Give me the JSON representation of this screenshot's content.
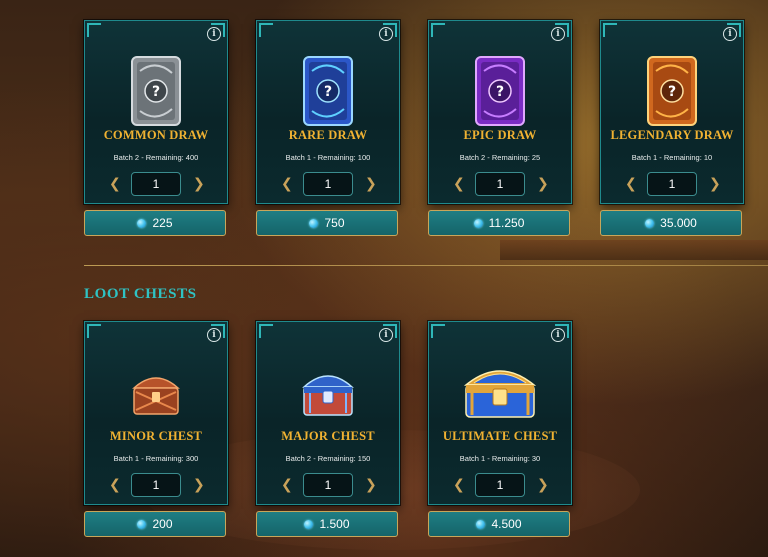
{
  "colors": {
    "title_gold": "#f0b232",
    "teal_accent": "#2fc3c3",
    "button_teal": "#1a737a",
    "gem_blue": "#46c4ef"
  },
  "draws": [
    {
      "name": "COMMON DRAW",
      "batch": "Batch 2 - Remaining: 400",
      "qty": "1",
      "price": "225",
      "art": "common-card-back"
    },
    {
      "name": "RARE DRAW",
      "batch": "Batch 1 - Remaining: 100",
      "qty": "1",
      "price": "750",
      "art": "rare-card-back"
    },
    {
      "name": "EPIC DRAW",
      "batch": "Batch 2 - Remaining: 25",
      "qty": "1",
      "price": "11.250",
      "art": "epic-card-back"
    },
    {
      "name": "LEGENDARY DRAW",
      "batch": "Batch 1 - Remaining: 10",
      "qty": "1",
      "price": "35.000",
      "art": "legendary-card-back"
    }
  ],
  "loot_section": {
    "title": "LOOT CHESTS"
  },
  "chests": [
    {
      "name": "MINOR CHEST",
      "batch": "Batch 1 - Remaining: 300",
      "qty": "1",
      "price": "200",
      "art": "minor-chest"
    },
    {
      "name": "MAJOR CHEST",
      "batch": "Batch 2 - Remaining: 150",
      "qty": "1",
      "price": "1.500",
      "art": "major-chest"
    },
    {
      "name": "ULTIMATE CHEST",
      "batch": "Batch 1 - Remaining: 30",
      "qty": "1",
      "price": "4.500",
      "art": "ultimate-chest"
    }
  ],
  "icons": {
    "info": "info-icon",
    "decrement": "chevron-left-icon",
    "increment": "chevron-right-icon",
    "currency": "gem-icon"
  }
}
